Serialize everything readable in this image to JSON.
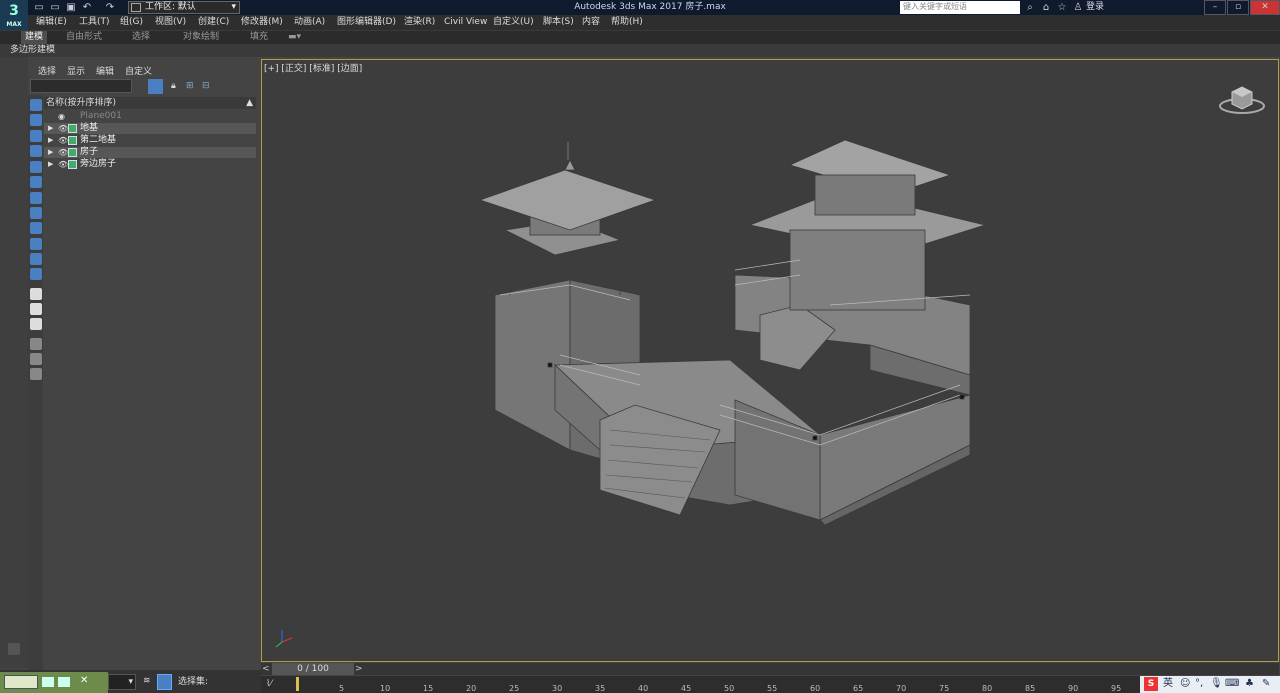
{
  "app": {
    "logo_text": "3",
    "logo_sub": "MAX",
    "title": "Autodesk 3ds Max 2017       房子.max",
    "workspace": "工作区: 默认",
    "search_placeholder": "键入关键字或短语",
    "login": "登录"
  },
  "menu": [
    "编辑(E)",
    "工具(T)",
    "组(G)",
    "视图(V)",
    "创建(C)",
    "修改器(M)",
    "动画(A)",
    "图形编辑器(D)",
    "渲染(R)",
    "Civil View",
    "自定义(U)",
    "脚本(S)",
    "内容",
    "帮助(H)"
  ],
  "ribbon_tabs": [
    "建模",
    "自由形式",
    "选择",
    "对象绘制",
    "填充"
  ],
  "ribbon_sub": "多边形建模",
  "scene_explorer": {
    "tabs": [
      "选择",
      "显示",
      "编辑",
      "自定义"
    ],
    "header": "名称(按升序排序)",
    "rows": [
      {
        "name": "Plane001"
      },
      {
        "name": "地基"
      },
      {
        "name": "第二地基"
      },
      {
        "name": "房子"
      },
      {
        "name": "旁边房子"
      }
    ]
  },
  "viewport": {
    "label": "[+] [正交] [标准] [边面]"
  },
  "time": {
    "slider": "0 / 100",
    "ticks": [
      "5",
      "10",
      "15",
      "20",
      "25",
      "30",
      "35",
      "40",
      "45",
      "50",
      "55",
      "60",
      "65",
      "70",
      "75",
      "80",
      "85",
      "90",
      "95"
    ]
  },
  "status": {
    "selection_set": "选择集:",
    "tray_lang": "英"
  },
  "colors": {
    "viewport_bg": "#3d3d3d",
    "viewport_border": "#b59a49",
    "panel_bg": "#444444",
    "title_bg": "#101a2d"
  }
}
